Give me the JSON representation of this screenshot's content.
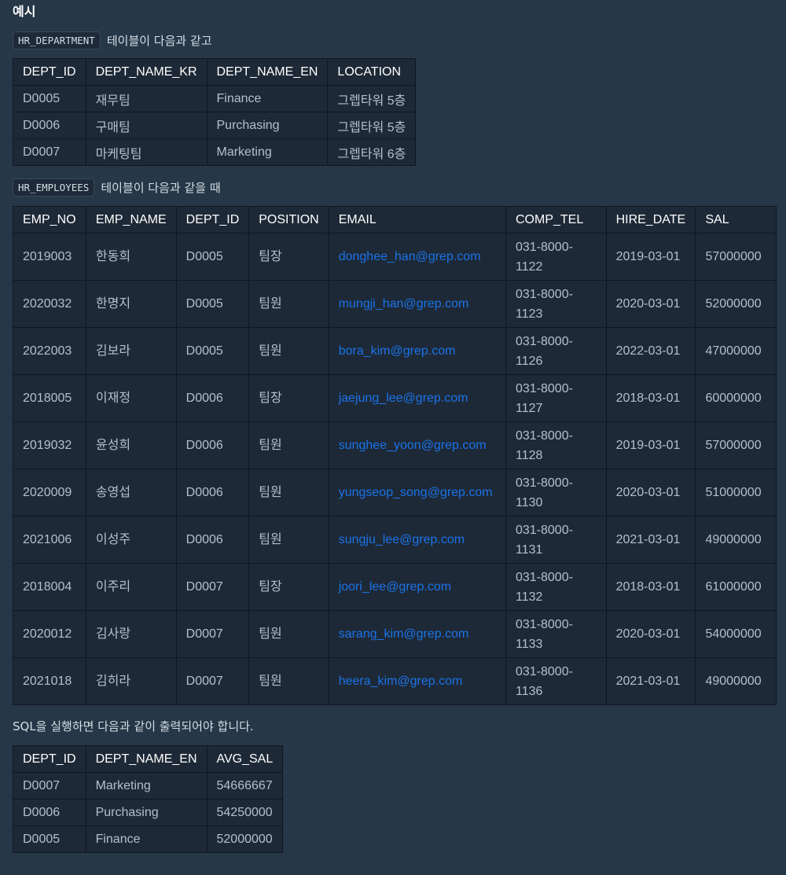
{
  "heading": "예시",
  "dept_caption": {
    "chip": "HR_DEPARTMENT",
    "text": "테이블이 다음과 같고"
  },
  "dept_table": {
    "headers": [
      "DEPT_ID",
      "DEPT_NAME_KR",
      "DEPT_NAME_EN",
      "LOCATION"
    ],
    "rows": [
      [
        "D0005",
        "재무팀",
        "Finance",
        "그렙타워 5층"
      ],
      [
        "D0006",
        "구매팀",
        "Purchasing",
        "그렙타워 5층"
      ],
      [
        "D0007",
        "마케팅팀",
        "Marketing",
        "그렙타워 6층"
      ]
    ]
  },
  "emp_caption": {
    "chip": "HR_EMPLOYEES",
    "text": "테이블이 다음과 같을 때"
  },
  "emp_table": {
    "headers": [
      "EMP_NO",
      "EMP_NAME",
      "DEPT_ID",
      "POSITION",
      "EMAIL",
      "COMP_TEL",
      "HIRE_DATE",
      "SAL"
    ],
    "rows": [
      [
        "2019003",
        "한동희",
        "D0005",
        "팀장",
        "donghee_han@grep.com",
        "031-8000-1122",
        "2019-03-01",
        "57000000"
      ],
      [
        "2020032",
        "한명지",
        "D0005",
        "팀원",
        "mungji_han@grep.com",
        "031-8000-1123",
        "2020-03-01",
        "52000000"
      ],
      [
        "2022003",
        "김보라",
        "D0005",
        "팀원",
        "bora_kim@grep.com",
        "031-8000-1126",
        "2022-03-01",
        "47000000"
      ],
      [
        "2018005",
        "이재정",
        "D0006",
        "팀장",
        "jaejung_lee@grep.com",
        "031-8000-1127",
        "2018-03-01",
        "60000000"
      ],
      [
        "2019032",
        "윤성희",
        "D0006",
        "팀원",
        "sunghee_yoon@grep.com",
        "031-8000-1128",
        "2019-03-01",
        "57000000"
      ],
      [
        "2020009",
        "송영섭",
        "D0006",
        "팀원",
        "yungseop_song@grep.com",
        "031-8000-1130",
        "2020-03-01",
        "51000000"
      ],
      [
        "2021006",
        "이성주",
        "D0006",
        "팀원",
        "sungju_lee@grep.com",
        "031-8000-1131",
        "2021-03-01",
        "49000000"
      ],
      [
        "2018004",
        "이주리",
        "D0007",
        "팀장",
        "joori_lee@grep.com",
        "031-8000-1132",
        "2018-03-01",
        "61000000"
      ],
      [
        "2020012",
        "김사랑",
        "D0007",
        "팀원",
        "sarang_kim@grep.com",
        "031-8000-1133",
        "2020-03-01",
        "54000000"
      ],
      [
        "2021018",
        "김히라",
        "D0007",
        "팀원",
        "heera_kim@grep.com",
        "031-8000-1136",
        "2021-03-01",
        "49000000"
      ]
    ]
  },
  "result_text": "SQL을 실행하면 다음과 같이 출력되어야 합니다.",
  "result_table": {
    "headers": [
      "DEPT_ID",
      "DEPT_NAME_EN",
      "AVG_SAL"
    ],
    "rows": [
      [
        "D0007",
        "Marketing",
        "54666667"
      ],
      [
        "D0006",
        "Purchasing",
        "54250000"
      ],
      [
        "D0005",
        "Finance",
        "52000000"
      ]
    ]
  },
  "colors": {
    "background": "#263747",
    "table_bg": "#1e2937",
    "link": "#1a73e8",
    "header_text": "#ffffff",
    "body_text": "#b2c0cc"
  }
}
